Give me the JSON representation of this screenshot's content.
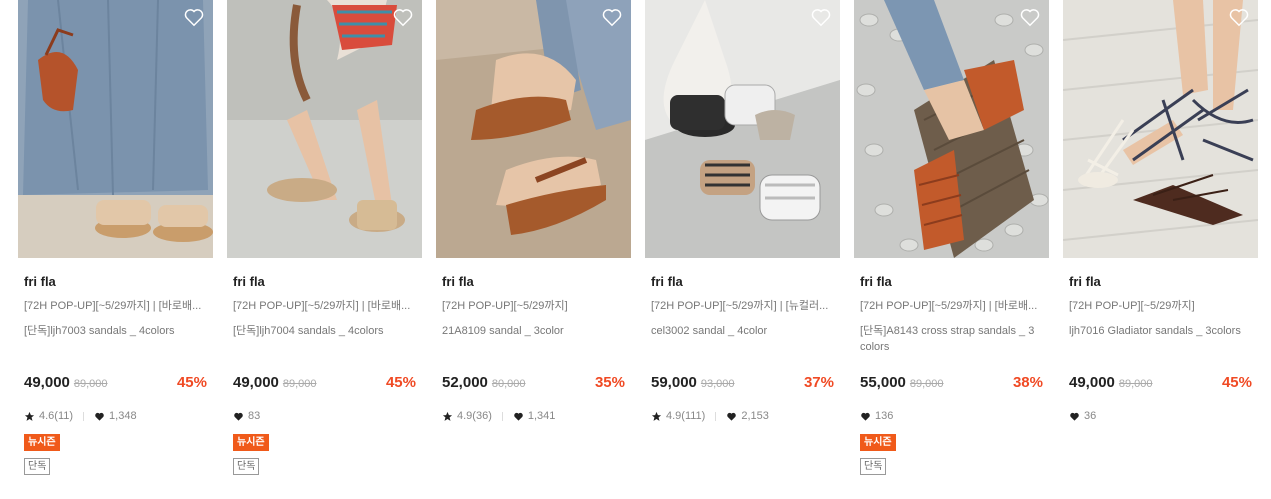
{
  "products": [
    {
      "brand": "fri fla",
      "title": "[72H POP-UP][~5/29까지] | [바로배...",
      "subtitle": "[단독]ljh7003 sandals _ 4colors",
      "price": "49,000",
      "original_price": "89,000",
      "discount": "45%",
      "rating": "4.6(11)",
      "likes": "1,348",
      "badge_new": "뉴시즌",
      "badge_only": "단독"
    },
    {
      "brand": "fri fla",
      "title": "[72H POP-UP][~5/29까지] | [바로배...",
      "subtitle": "[단독]ljh7004 sandals _ 4colors",
      "price": "49,000",
      "original_price": "89,000",
      "discount": "45%",
      "likes": "83",
      "badge_new": "뉴시즌",
      "badge_only": "단독"
    },
    {
      "brand": "fri fla",
      "title": "[72H POP-UP][~5/29까지]",
      "subtitle": "21A8109 sandal _ 3color",
      "price": "52,000",
      "original_price": "80,000",
      "discount": "35%",
      "rating": "4.9(36)",
      "likes": "1,341"
    },
    {
      "brand": "fri fla",
      "title": "[72H POP-UP][~5/29까지] | [뉴컬러...",
      "subtitle": "cel3002 sandal _ 4color",
      "price": "59,000",
      "original_price": "93,000",
      "discount": "37%",
      "rating": "4.9(111)",
      "likes": "2,153"
    },
    {
      "brand": "fri fla",
      "title": "[72H POP-UP][~5/29까지] | [바로배...",
      "subtitle": "[단독]A8143 cross strap sandals _ 3 colors",
      "price": "55,000",
      "original_price": "89,000",
      "discount": "38%",
      "likes": "136",
      "badge_new": "뉴시즌",
      "badge_only": "단독"
    },
    {
      "brand": "fri fla",
      "title": "[72H POP-UP][~5/29까지]",
      "subtitle": "ljh7016 Gladiator sandals _ 3colors",
      "price": "49,000",
      "original_price": "89,000",
      "discount": "45%",
      "likes": "36"
    }
  ],
  "icons": {
    "wishlist": "heart-outline-icon",
    "rating": "star-icon",
    "likes": "heart-filled-icon"
  },
  "colors": {
    "discount": "#f04a24",
    "badge_new_bg": "#f05a1a",
    "text_primary": "#222222",
    "text_secondary": "#777777"
  }
}
